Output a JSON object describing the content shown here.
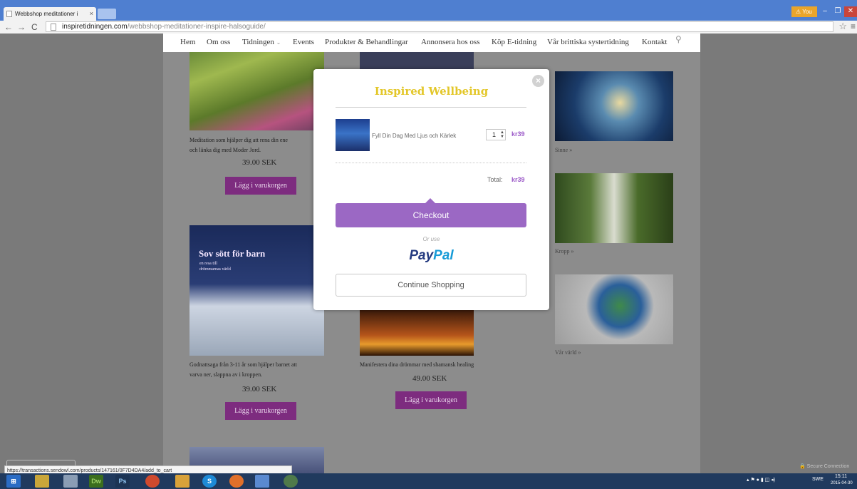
{
  "browser": {
    "tab_title": "Webbshop meditationer i",
    "tab_close": "×",
    "user_label": "You",
    "url_host": "inspiretidningen.com",
    "url_path": "/webbshop-meditationer-inspire-halsoguide/"
  },
  "nav": {
    "items": [
      "Hem",
      "Om oss",
      "Tidningen",
      "Events",
      "Produkter & Behandlingar",
      "Annonsera hos oss",
      "Köp E-tidning",
      "Vår brittiska systertidning",
      "Kontakt"
    ],
    "tidningen_caret": "⌄"
  },
  "products": [
    {
      "caption_l1": "Meditation som hjälper dig att rena din ene",
      "caption_l2": "och länka dig med Moder Jord.",
      "price": "39.00 SEK",
      "button": "Lägg i varukorgen"
    },
    {
      "image_title": "Sov sött för barn",
      "image_sub1": "en resa till",
      "image_sub2": "drömmarnas värld",
      "caption_l1": "Godnattsaga från 3-11 år som hjälper barnet att",
      "caption_l2": "varva ner, slappna av i kroppen.",
      "price": "39.00 SEK",
      "button": "Lägg i varukorgen"
    },
    {
      "caption_l1": "Manifestera dina drömmar med shamansk healing",
      "price": "49.00 SEK",
      "button": "Lägg i varukorgen"
    }
  ],
  "sidebar_links": [
    "Sinne »",
    "Kropp »",
    "Vår värld »"
  ],
  "cart": {
    "title": "Inspired Wellbeing",
    "close": "×",
    "item_name": "Fyll Din Dag Med Ljus och Kärlek",
    "quantity": "1",
    "item_price": "kr39",
    "total_label": "Total:",
    "total_value": "kr39",
    "checkout": "Checkout",
    "or_use": "Or use",
    "paypal_a": "Pay",
    "paypal_b": "Pal",
    "continue": "Continue Shopping"
  },
  "status": {
    "link_url": "https://transactions.sendowl.com/products/147161/0F7D4DA4/add_to_cart",
    "secure": "Secure Connection"
  },
  "taskbar": {
    "lang": "SWE",
    "time": "15:11",
    "date": "2015-04-30"
  },
  "colors": {
    "accent_purple": "#9b68c4",
    "button_purple": "#7d2c7f",
    "title_yellow": "#e3c72a"
  }
}
